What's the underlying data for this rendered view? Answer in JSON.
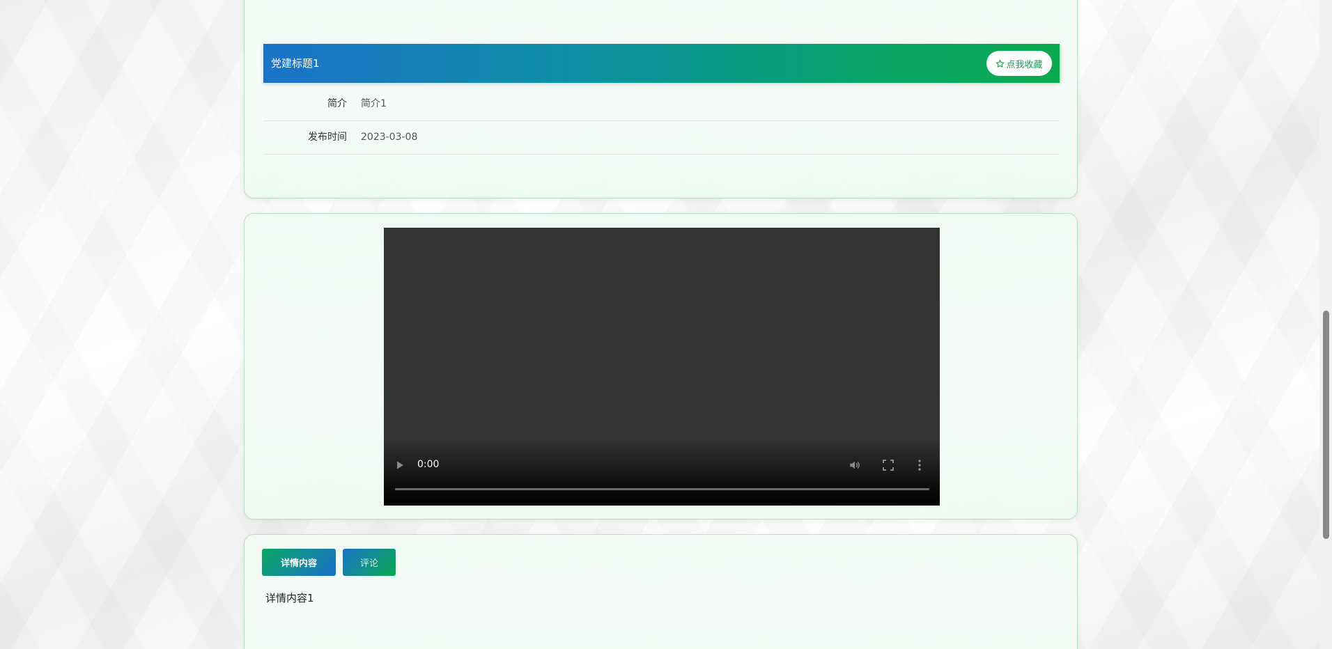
{
  "article": {
    "title": "党建标题1",
    "favorite_label": "点我收藏",
    "fields": [
      {
        "label": "简介",
        "value": "简介1"
      },
      {
        "label": "发布时间",
        "value": "2023-03-08"
      }
    ]
  },
  "video": {
    "current_time": "0:00",
    "progress": 0
  },
  "tabs": [
    {
      "label": "详情内容",
      "active": true
    },
    {
      "label": "评论",
      "active": false
    }
  ],
  "detail": {
    "content": "详情内容1"
  },
  "colors": {
    "accent_green": "#0aab4f",
    "accent_blue": "#1a73c9",
    "card_border": "#b9e3c6"
  },
  "icons": [
    "star-icon",
    "play-icon",
    "volume-icon",
    "fullscreen-icon",
    "more-options-icon"
  ]
}
